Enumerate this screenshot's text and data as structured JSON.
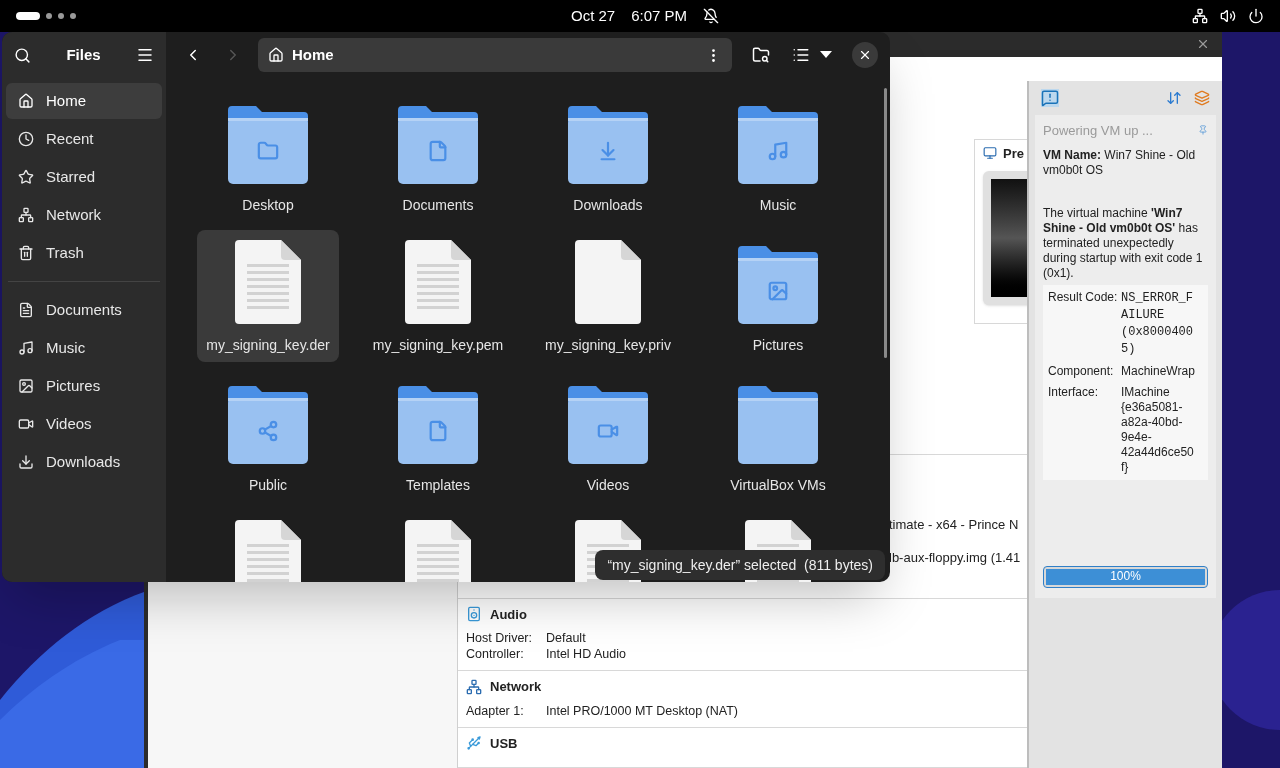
{
  "top_bar": {
    "date": "Oct 27",
    "time": "6:07 PM",
    "workspaces": [
      {
        "selected": true
      },
      {
        "selected": false
      },
      {
        "selected": false
      },
      {
        "selected": false
      }
    ]
  },
  "files_window": {
    "title": "Files",
    "location": "Home",
    "forward_enabled": false,
    "sidebar": [
      {
        "label": "Home",
        "kind": "home",
        "selected": true
      },
      {
        "label": "Recent",
        "kind": "recent",
        "selected": false
      },
      {
        "label": "Starred",
        "kind": "starred",
        "selected": false
      },
      {
        "label": "Network",
        "kind": "network",
        "selected": false
      },
      {
        "label": "Trash",
        "kind": "trash",
        "selected": false
      }
    ],
    "bookmarks": [
      {
        "label": "Documents",
        "kind": "documents",
        "selected": false
      },
      {
        "label": "Music",
        "kind": "music",
        "selected": false
      },
      {
        "label": "Pictures",
        "kind": "pictures",
        "selected": false
      },
      {
        "label": "Videos",
        "kind": "videos",
        "selected": false
      },
      {
        "label": "Downloads",
        "kind": "downloads",
        "selected": false
      }
    ],
    "items": [
      {
        "name": "Desktop",
        "kind": "desktop",
        "selected": false
      },
      {
        "name": "Documents",
        "kind": "documents",
        "selected": false
      },
      {
        "name": "Downloads",
        "kind": "downloads",
        "selected": false
      },
      {
        "name": "Music",
        "kind": "music",
        "selected": false
      },
      {
        "name": "my_signing_key.der",
        "kind": "textfile",
        "selected": true
      },
      {
        "name": "my_signing_key.pem",
        "kind": "textfile",
        "selected": false
      },
      {
        "name": "my_signing_key.priv",
        "kind": "blankfile",
        "selected": false
      },
      {
        "name": "Pictures",
        "kind": "pictures",
        "selected": false
      },
      {
        "name": "Public",
        "kind": "public",
        "selected": false
      },
      {
        "name": "Templates",
        "kind": "templates",
        "selected": false
      },
      {
        "name": "Videos",
        "kind": "videos",
        "selected": false
      },
      {
        "name": "VirtualBox VMs",
        "kind": "folder",
        "selected": false
      },
      {
        "kind": "textfile",
        "selected": false
      },
      {
        "kind": "textfile",
        "selected": false
      },
      {
        "kind": "textfile",
        "selected": false
      },
      {
        "kind": "textfile",
        "selected": false
      }
    ],
    "status": "“my_signing_key.der” selected  (811 bytes)"
  },
  "virtualbox_window": {
    "preview_heading": "Pre",
    "fragments": [
      "timate - x64 - Prince N",
      "lb-aux-floppy.img (1.41"
    ],
    "sections": [
      {
        "title": "Audio",
        "kind": "audio",
        "rows": [
          {
            "label": "Host Driver:",
            "value": "Default"
          },
          {
            "label": "Controller:",
            "value": "Intel HD Audio"
          }
        ]
      },
      {
        "title": "Network",
        "kind": "network",
        "rows": [
          {
            "label": "Adapter 1:",
            "value": "Intel PRO/1000 MT Desktop (NAT)"
          }
        ]
      },
      {
        "title": "USB",
        "kind": "usb"
      }
    ],
    "notification": {
      "title": "Powering VM up ...",
      "vm_name_label": "VM Name:",
      "vm_name": "Win7 Shine - Old vm0b0t OS",
      "message": "The virtual machine **'Win7 Shine - Old vm0b0t OS'** has terminated unexpectedly during startup with exit code 1 (0x1).",
      "details": [
        {
          "label": "Result Code:",
          "value": "NS_ERROR_FAILURE (0x80004005)",
          "kind": "code"
        },
        {
          "label": "Component:",
          "value": "MachineWrap",
          "kind": "text"
        },
        {
          "label": "Interface:",
          "value": "IMachine {e36a5081-a82a-40bd-9e4e-42a44d6ce50f}",
          "kind": "text"
        }
      ],
      "progress": {
        "level": 1,
        "text": "100%"
      }
    }
  }
}
